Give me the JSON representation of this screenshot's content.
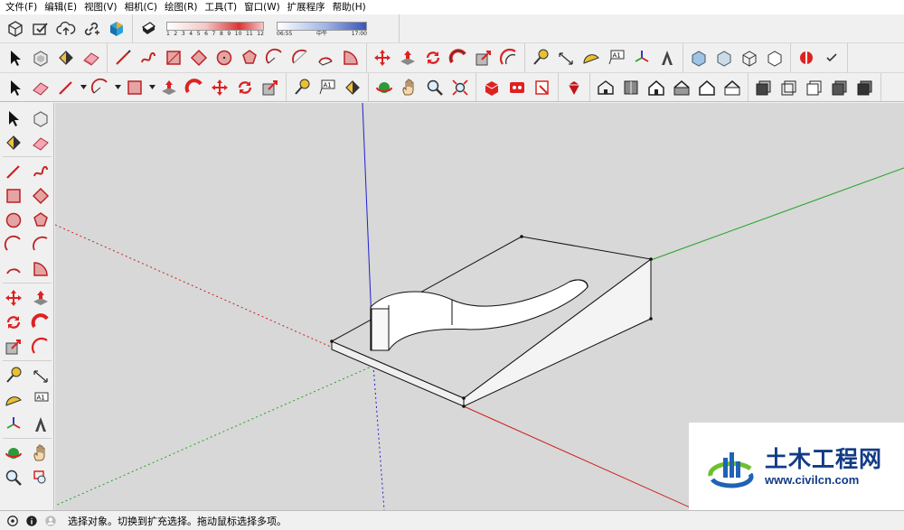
{
  "menu": {
    "items": [
      "文件(F)",
      "编辑(E)",
      "视图(V)",
      "相机(C)",
      "绘图(R)",
      "工具(T)",
      "窗口(W)",
      "扩展程序",
      "帮助(H)"
    ]
  },
  "shadow_settings": {
    "month_scale": [
      "1",
      "2",
      "3",
      "4",
      "5",
      "6",
      "7",
      "8",
      "9",
      "10",
      "11",
      "12"
    ],
    "time_start": "06:55",
    "time_mid": "中午",
    "time_end": "17:00"
  },
  "status": {
    "message": "选择对象。切换到扩充选择。拖动鼠标选择多项。"
  },
  "watermark": {
    "title": "土木工程网",
    "url": "www.civilcn.com"
  },
  "colors": {
    "axis_red": "#cc2020",
    "axis_green": "#24a424",
    "axis_blue": "#2020cc",
    "viewport_bg": "#d8d8d8",
    "model_face": "#f2f2f2",
    "model_shade": "#c8c8c8",
    "brand_blue": "#123b86"
  },
  "icons": {
    "toolbar_row1": [
      "component-icon",
      "check-icon",
      "cloud-upload-icon",
      "link-icon",
      "extension-warehouse-icon",
      "shadow-toggle-icon"
    ],
    "toolbar_row2": [
      "select-icon",
      "make-component-icon",
      "paint-bucket-icon",
      "eraser-icon",
      "line-icon",
      "freehand-icon",
      "rectangle-icon",
      "rotated-rectangle-icon",
      "circle-icon",
      "polygon-icon",
      "arc-icon",
      "two-point-arc-icon",
      "three-point-arc-icon",
      "pie-icon",
      "move-icon",
      "push-pull-icon",
      "rotate-icon",
      "follow-me-icon",
      "scale-icon",
      "offset-icon",
      "tape-measure-icon",
      "dimension-icon",
      "protractor-icon",
      "text-icon",
      "axes-icon",
      "3d-text-icon",
      "xray-icon",
      "back-edges-icon",
      "wireframe-icon",
      "hidden-line-icon",
      "section-plane-icon",
      "check-icon"
    ],
    "toolbar_row3": [
      "select-icon",
      "eraser-icon",
      "line-icon",
      "arc-icon",
      "shape-icon",
      "push-pull-icon",
      "follow-me-icon",
      "move-icon",
      "rotate-icon",
      "scale-icon",
      "tape-measure-icon",
      "text-icon",
      "paint-bucket-icon",
      "orbit-icon",
      "pan-icon",
      "zoom-icon",
      "zoom-extents-icon",
      "warehouse-icon",
      "extension-icon",
      "layout-icon",
      "ruby-icon",
      "iso-view-icon",
      "top-view-icon",
      "front-view-icon",
      "right-view-icon",
      "back-view-icon",
      "left-view-icon",
      "xray-style-icon",
      "wire-style-icon",
      "hidden-style-icon",
      "shaded-style-icon",
      "textured-style-icon"
    ]
  }
}
